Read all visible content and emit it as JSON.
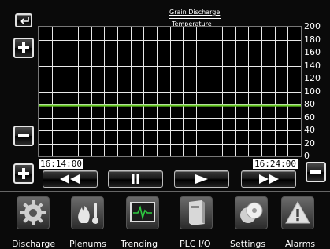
{
  "header": {
    "legend_series": [
      "Grain Discharge",
      "Temperature"
    ]
  },
  "chart_data": {
    "type": "line",
    "x": [
      "16:14:00",
      "16:24:00"
    ],
    "series": [
      {
        "name": "Grain Discharge",
        "values": [],
        "color": "#ffffff"
      },
      {
        "name": "Temperature",
        "values": [
          78,
          78
        ],
        "color": "#66cc22"
      }
    ],
    "ylim": [
      0,
      200
    ],
    "yticks": [
      "200",
      "180",
      "160",
      "140",
      "120",
      "100",
      "80",
      "60",
      "40",
      "20",
      "0"
    ],
    "x_start_label": "16:14:00",
    "x_end_label": "16:24:00",
    "grid": true
  },
  "controls": {
    "back_icon": "back-arrow-icon",
    "zoom_in_icon": "plus-icon",
    "zoom_out_icon": "minus-icon",
    "transport": [
      "rewind-icon",
      "pause-icon",
      "play-icon",
      "fast-forward-icon"
    ]
  },
  "nav": [
    {
      "label": "Discharge",
      "icon": "gear-icon"
    },
    {
      "label": "Plenums",
      "icon": "flame-thermometer-icon"
    },
    {
      "label": "Trending",
      "icon": "trend-monitor-icon"
    },
    {
      "label": "PLC I/O",
      "icon": "plc-cabinet-icon"
    },
    {
      "label": "Settings",
      "icon": "discs-icon"
    },
    {
      "label": "Alarms",
      "icon": "warning-icon"
    }
  ],
  "colors": {
    "accent_green": "#66cc22",
    "grid": "#e8e8e8",
    "background": "#0a0a0a"
  }
}
